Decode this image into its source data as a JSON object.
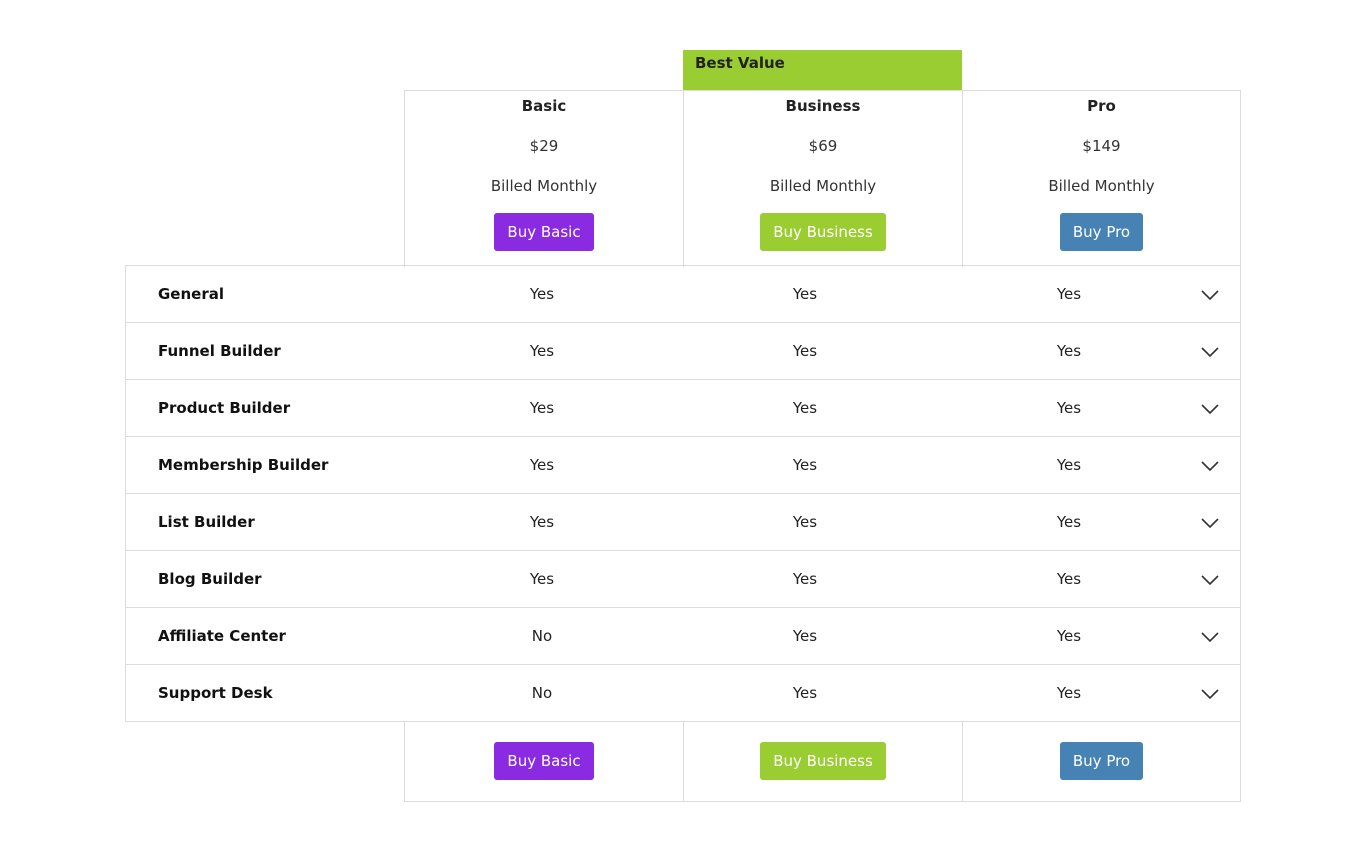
{
  "badge": {
    "label": "Best Value"
  },
  "plans": [
    {
      "name": "Basic",
      "price": "$29",
      "billing": "Billed Monthly",
      "button": "Buy Basic",
      "color": "#8a2be2"
    },
    {
      "name": "Business",
      "price": "$69",
      "billing": "Billed Monthly",
      "button": "Buy Business",
      "color": "#9acd32"
    },
    {
      "name": "Pro",
      "price": "$149",
      "billing": "Billed Monthly",
      "button": "Buy Pro",
      "color": "#4682b4"
    }
  ],
  "features": [
    {
      "name": "General",
      "values": [
        "Yes",
        "Yes",
        "Yes"
      ]
    },
    {
      "name": "Funnel Builder",
      "values": [
        "Yes",
        "Yes",
        "Yes"
      ]
    },
    {
      "name": "Product Builder",
      "values": [
        "Yes",
        "Yes",
        "Yes"
      ]
    },
    {
      "name": "Membership Builder",
      "values": [
        "Yes",
        "Yes",
        "Yes"
      ]
    },
    {
      "name": "List Builder",
      "values": [
        "Yes",
        "Yes",
        "Yes"
      ]
    },
    {
      "name": "Blog Builder",
      "values": [
        "Yes",
        "Yes",
        "Yes"
      ]
    },
    {
      "name": "Affiliate Center",
      "values": [
        "No",
        "Yes",
        "Yes"
      ]
    },
    {
      "name": "Support Desk",
      "values": [
        "No",
        "Yes",
        "Yes"
      ]
    }
  ],
  "icons": {
    "expand": "chevron-down-icon"
  }
}
